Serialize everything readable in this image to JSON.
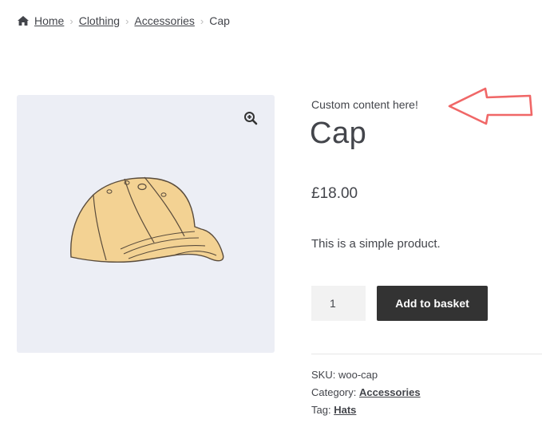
{
  "breadcrumb": {
    "home": "Home",
    "clothing": "Clothing",
    "accessories": "Accessories",
    "current": "Cap",
    "separator": "›"
  },
  "gallery": {
    "background_color": "#eceef5",
    "zoom_icon": "magnifier-plus-icon"
  },
  "product": {
    "custom_content": "Custom content here!",
    "title": "Cap",
    "price": "£18.00",
    "short_description": "This is a simple product.",
    "quantity": "1",
    "add_to_basket_label": "Add to basket",
    "sku_label": "SKU:",
    "sku_value": "woo-cap",
    "category_label": "Category:",
    "category_value": "Accessories",
    "tag_label": "Tag:",
    "tag_value": "Hats"
  },
  "annotation": {
    "arrow_icon": "left-arrow-outline-icon",
    "arrow_color": "#f06767"
  },
  "colors": {
    "text": "#43454b",
    "button_bg": "#333333",
    "button_text": "#ffffff",
    "quantity_bg": "#f2f2f2"
  }
}
